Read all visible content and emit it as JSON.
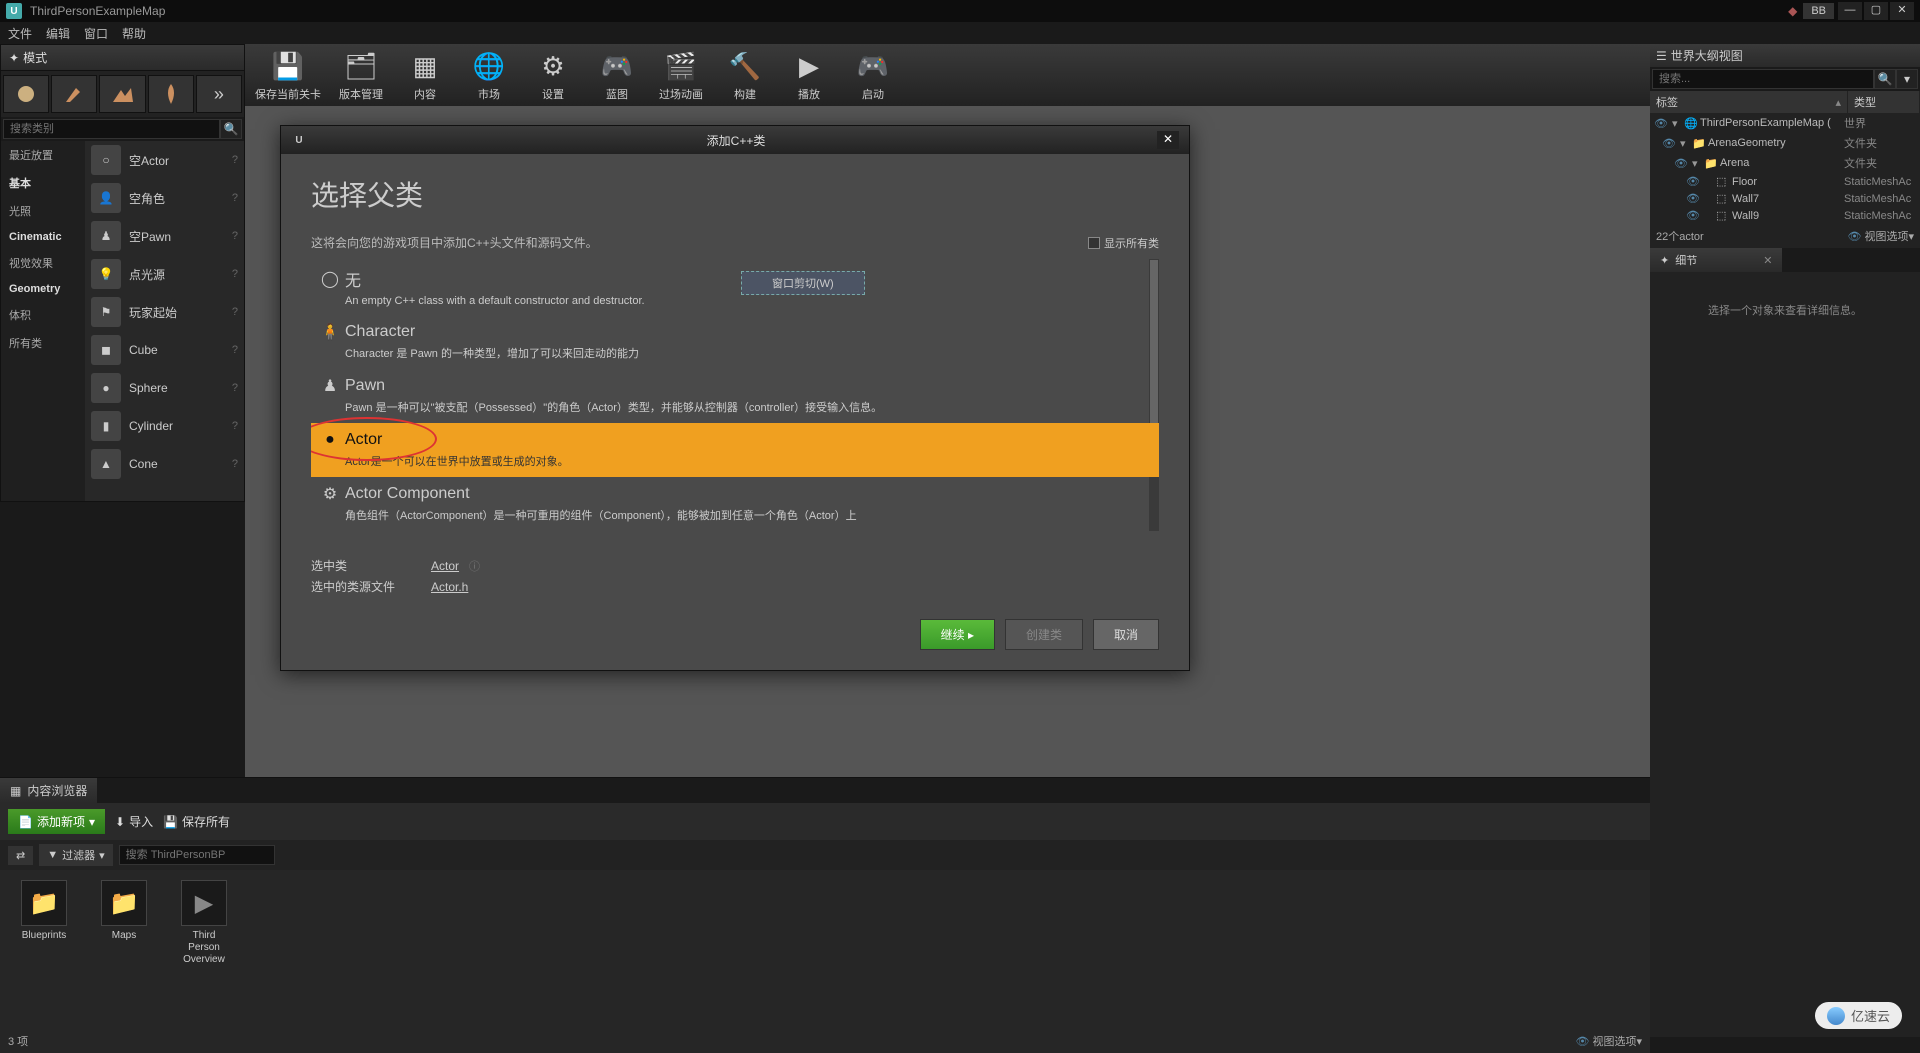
{
  "title_bar": {
    "project": "ThirdPersonExampleMap",
    "user": "BB"
  },
  "menu": {
    "file": "文件",
    "edit": "编辑",
    "window": "窗口",
    "help": "帮助"
  },
  "modes_panel": {
    "title": "模式",
    "search_placeholder": "搜索类别",
    "categories": [
      {
        "label": "最近放置",
        "strong": false
      },
      {
        "label": "基本",
        "strong": true
      },
      {
        "label": "光照",
        "strong": false
      },
      {
        "label": "Cinematic",
        "strong": true
      },
      {
        "label": "视觉效果",
        "strong": false
      },
      {
        "label": "Geometry",
        "strong": true
      },
      {
        "label": "体积",
        "strong": false
      },
      {
        "label": "所有类",
        "strong": false
      }
    ],
    "actors": [
      {
        "name": "空Actor"
      },
      {
        "name": "空角色"
      },
      {
        "name": "空Pawn"
      },
      {
        "name": "点光源"
      },
      {
        "name": "玩家起始"
      },
      {
        "name": "Cube"
      },
      {
        "name": "Sphere"
      },
      {
        "name": "Cylinder"
      },
      {
        "name": "Cone"
      }
    ]
  },
  "toolbar": [
    {
      "label": "保存当前关卡",
      "icon": "save"
    },
    {
      "label": "版本管理",
      "icon": "source"
    },
    {
      "label": "内容",
      "icon": "content"
    },
    {
      "label": "市场",
      "icon": "market"
    },
    {
      "label": "设置",
      "icon": "settings"
    },
    {
      "label": "蓝图",
      "icon": "blueprint"
    },
    {
      "label": "过场动画",
      "icon": "cine"
    },
    {
      "label": "构建",
      "icon": "build"
    },
    {
      "label": "播放",
      "icon": "play"
    },
    {
      "label": "启动",
      "icon": "launch"
    }
  ],
  "outliner": {
    "title": "世界大纲视图",
    "search_placeholder": "搜索...",
    "col_label": "标签",
    "col_type": "类型",
    "rows": [
      {
        "lvl": 0,
        "tri": "▾",
        "name": "ThirdPersonExampleMap (",
        "type": "世界",
        "icon": "world"
      },
      {
        "lvl": 1,
        "tri": "▾",
        "name": "ArenaGeometry",
        "type": "文件夹",
        "icon": "folder"
      },
      {
        "lvl": 2,
        "tri": "▾",
        "name": "Arena",
        "type": "文件夹",
        "icon": "folder"
      },
      {
        "lvl": 3,
        "tri": "",
        "name": "Floor",
        "type": "StaticMeshAc",
        "icon": "mesh"
      },
      {
        "lvl": 3,
        "tri": "",
        "name": "Wall7",
        "type": "StaticMeshAc",
        "icon": "mesh"
      },
      {
        "lvl": 3,
        "tri": "",
        "name": "Wall9",
        "type": "StaticMeshAc",
        "icon": "mesh"
      }
    ],
    "count": "22个actor",
    "view_options": "视图选项"
  },
  "details": {
    "title": "细节",
    "empty": "选择一个对象来查看详细信息。"
  },
  "content_browser": {
    "title": "内容浏览器",
    "add": "添加新项",
    "import": "导入",
    "save_all": "保存所有",
    "filter": "过滤器",
    "search_placeholder": "搜索 ThirdPersonBP",
    "items": [
      {
        "name": "Blueprints",
        "type": "folder"
      },
      {
        "name": "Maps",
        "type": "folder"
      },
      {
        "name": "Third\nPerson\nOverview",
        "type": "asset"
      }
    ],
    "count": "3 项",
    "view_options": "视图选项"
  },
  "modal": {
    "title": "添加C++类",
    "heading": "选择父类",
    "description": "这将会向您的游戏项目中添加C++头文件和源码文件。",
    "show_all": "显示所有类",
    "window_hint": "窗口剪切(W)",
    "classes": [
      {
        "name": "无",
        "desc": "An empty C++ class with a default constructor and destructor.",
        "selected": false,
        "icon": "○"
      },
      {
        "name": "Character",
        "desc": "Character 是 Pawn 的一种类型，增加了可以来回走动的能力",
        "selected": false,
        "icon": "char"
      },
      {
        "name": "Pawn",
        "desc": "Pawn 是一种可以\"被支配（Possessed）\"的角色（Actor）类型，并能够从控制器（controller）接受输入信息。",
        "selected": false,
        "icon": "pawn"
      },
      {
        "name": "Actor",
        "desc": "Actor是一个可以在世界中放置或生成的对象。",
        "selected": true,
        "icon": "actor"
      },
      {
        "name": "Actor Component",
        "desc": "角色组件（ActorComponent）是一种可重用的组件（Component），能够被加到任意一个角色（Actor）上",
        "selected": false,
        "icon": "comp"
      }
    ],
    "selected_class_label": "选中类",
    "selected_class_value": "Actor",
    "selected_file_label": "选中的类源文件",
    "selected_file_value": "Actor.h",
    "btn_next": "继续 ▸",
    "btn_create": "创建类",
    "btn_cancel": "取消"
  },
  "watermark": "亿速云"
}
